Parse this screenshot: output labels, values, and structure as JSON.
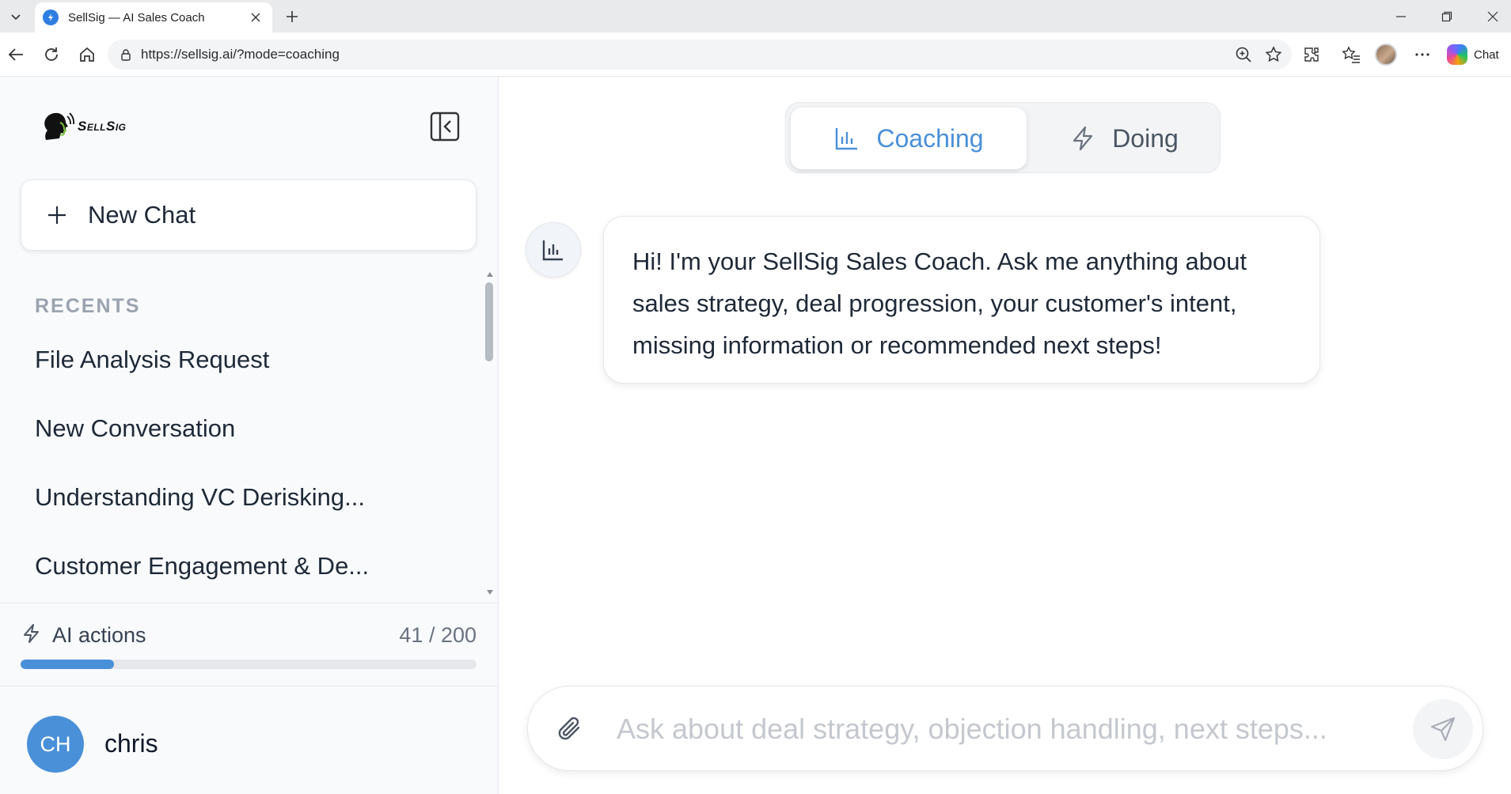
{
  "browser": {
    "tab_title": "SellSig — AI Sales Coach",
    "url": "https://sellsig.ai/?mode=coaching",
    "copilot_label": "Chat"
  },
  "sidebar": {
    "logo_text": "SellSig",
    "new_chat_label": "New Chat",
    "recents_header": "RECENTS",
    "recents": [
      "File Analysis Request",
      "New Conversation",
      "Understanding VC Derisking...",
      "Customer Engagement & De..."
    ],
    "ai_actions": {
      "label": "AI actions",
      "count_text": "41 / 200",
      "used": 41,
      "total": 200
    },
    "user": {
      "initials": "CH",
      "name": "chris"
    }
  },
  "main": {
    "modes": {
      "active": "Coaching",
      "inactive": "Doing"
    },
    "messages": [
      {
        "role": "assistant",
        "text": "Hi! I'm your SellSig Sales Coach. Ask me anything about sales strategy, deal progression, your customer's intent, missing information or recommended next steps!"
      }
    ],
    "composer": {
      "placeholder": "Ask about deal strategy, objection handling, next steps..."
    }
  },
  "colors": {
    "accent": "#4a90d9",
    "sidebar_bg": "#f8fafc",
    "muted_text": "#9ca3af"
  }
}
